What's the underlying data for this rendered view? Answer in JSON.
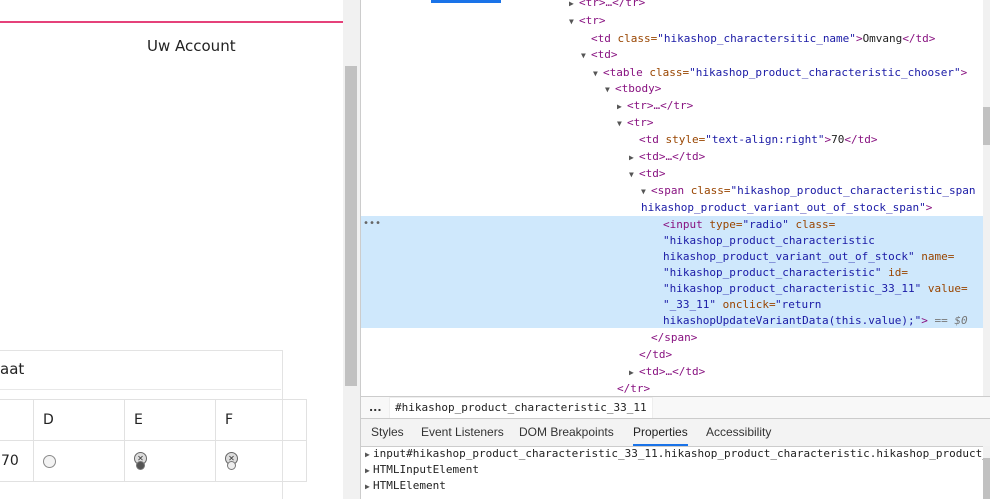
{
  "page": {
    "account_label": "Uw Account",
    "size_label": "aat",
    "size_table": {
      "headers": [
        "",
        "D",
        "E",
        "F"
      ],
      "rows": [
        [
          "70",
          "",
          "",
          ""
        ]
      ]
    }
  },
  "devtools": {
    "elements": {
      "lines": [
        {
          "text": "<tr>…</tr>"
        },
        {
          "text": "<tr>"
        },
        {
          "tag1": "<td ",
          "attr": "class=",
          "val": "\"hikashop_charactersitic_name\"",
          "tag2": ">",
          "txt": "Omvang",
          "tag3": "</td>"
        },
        {
          "text": "<td>"
        },
        {
          "tag1": "<table ",
          "attr": "class=",
          "val": "\"hikashop_product_characteristic_chooser\"",
          "tag2": ">"
        },
        {
          "text": "<tbody>"
        },
        {
          "text": "<tr>…</tr>"
        },
        {
          "text": "<tr>"
        },
        {
          "tag1": "<td ",
          "attr": "style=",
          "val": "\"text-align:right\"",
          "tag2": ">",
          "txt": "70",
          "tag3": "</td>"
        },
        {
          "text": "<td>…</td>"
        },
        {
          "text": "<td>"
        },
        {
          "tag1": "<span ",
          "attr": "class=",
          "val": "\"hikashop_product_characteristic_span"
        },
        {
          "val": "hikashop_product_variant_out_of_stock_span\"",
          "tag2": ">"
        },
        {
          "tag1": "<input ",
          "attr": "type=",
          "val": "\"radio\"",
          "attr2": " class="
        },
        {
          "val": "\"hikashop_product_characteristic"
        },
        {
          "val": "hikashop_product_variant_out_of_stock\"",
          "attr2": " name="
        },
        {
          "val": "\"hikashop_product_characteristic\"",
          "attr2": " id="
        },
        {
          "val": "\"hikashop_product_characteristic_33_11\"",
          "attr2": " value="
        },
        {
          "val": "\"_33_11\"",
          "attr2": " onclick="
        },
        {
          "val": "\"return"
        },
        {
          "val": "hikashopUpdateVariantData(this.value);\"",
          "tag2": ">",
          "eq": " == $0"
        },
        {
          "text": "</span>"
        },
        {
          "text": "</td>"
        },
        {
          "text": "<td>…</td>"
        },
        {
          "text": "</tr>"
        }
      ]
    },
    "breadcrumb": {
      "more": "...",
      "selected": "#hikashop_product_characteristic_33_11"
    },
    "tabs": [
      "Styles",
      "Event Listeners",
      "DOM Breakpoints",
      "Properties",
      "Accessibility"
    ],
    "active_tab": "Properties",
    "properties": [
      "input#hikashop_product_characteristic_33_11.hikashop_product_characteristic.hikashop_product_",
      "HTMLInputElement",
      "HTMLElement"
    ]
  }
}
